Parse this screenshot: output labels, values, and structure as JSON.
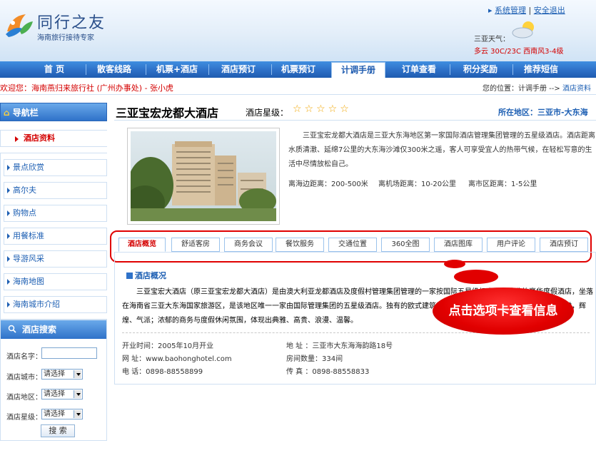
{
  "header": {
    "brand": "同行之友",
    "tagline": "海南旅行接待专家",
    "links": {
      "system": "系统管理",
      "sep": "|",
      "logout": "安全退出"
    },
    "weather": {
      "label": "三亚天气：",
      "detail": "多云  30C/23C  西南风3-4级"
    }
  },
  "nav": {
    "items": [
      "首 页",
      "散客线路",
      "机票+酒店",
      "酒店预订",
      "机票预订",
      "计调手册",
      "订单查看",
      "积分奖励",
      "推荐短信"
    ],
    "active": "计调手册"
  },
  "infobar": {
    "greeting": "欢迎您：海南燕归来旅行社 (广州办事处) - 张小虎",
    "location_prefix": "您的位置：计调手册 -->",
    "location_current": "酒店资料"
  },
  "sidebar": {
    "header": "导航栏",
    "current": "酒店资料",
    "items": [
      "景点欣赏",
      "高尔夫",
      "购物点",
      "用餐标准",
      "导游风采",
      "海南地图",
      "海南城市介绍"
    ]
  },
  "search": {
    "header": "酒店搜索",
    "name_label": "酒店名字：",
    "city_label": "酒店城市：",
    "area_label": "酒店地区：",
    "star_label": "酒店星级：",
    "select_placeholder": "请选择",
    "button": "搜 索"
  },
  "hotel": {
    "name": "三亚宝宏龙都大酒店",
    "star_label": "酒店星级：",
    "stars": "☆☆☆☆☆",
    "region": "所在地区：三亚市-大东海",
    "description": "三亚宝宏龙都大酒店是三亚大东海地区第一家国际酒店管理集团管理的五星级酒店。酒店距离水质清澈、延绵7公里的大东海沙滩仅300米之遥，客人可享受宜人的热带气候，在轻松写意的生活中尽情放松自己。",
    "distances": {
      "beach": "离海边距离：200-500米",
      "airport": "离机场距离：10-20公里",
      "downtown": "离市区距离：1-5公里"
    }
  },
  "tabs": {
    "items": [
      "酒店概览",
      "舒适客房",
      "商务会议",
      "餐饮服务",
      "交通位置",
      "360全图",
      "酒店图库",
      "用户评论",
      "酒店预订"
    ],
    "active": "酒店概览"
  },
  "overview": {
    "title": "酒店概况",
    "text": "三亚宝宏大酒店（原三亚宝宏龙都大酒店）是由澳大利亚龙都酒店及度假村管理集团管理的一家按国际五星级标准设计建造的豪华度假酒店，坐落在海南省三亚大东海国家旅游区，是该地区唯一一家由国际管理集团的五星级酒店。独有的欧式建筑风格，华丽的外观，金碧辉煌的大理石大堂，辉煌、气派；浓郁的商务与度假休闲氛围，体现出典雅、高贵、浪漫、温馨。",
    "open_time": "开业时间：2005年10月开业",
    "website": "网  址：www.baohonghotel.com",
    "phone": "电  话：0898-88558899",
    "address": "地  址 ：三亚市大东海海韵路18号",
    "rooms": "房间数量：334间",
    "fax": "传  真 ：0898-88558833"
  },
  "callout": "点击选项卡查看信息",
  "colors": {
    "nav_blue": "#2f72c9",
    "accent_red": "#d40000",
    "link_blue": "#1d5fb3"
  }
}
